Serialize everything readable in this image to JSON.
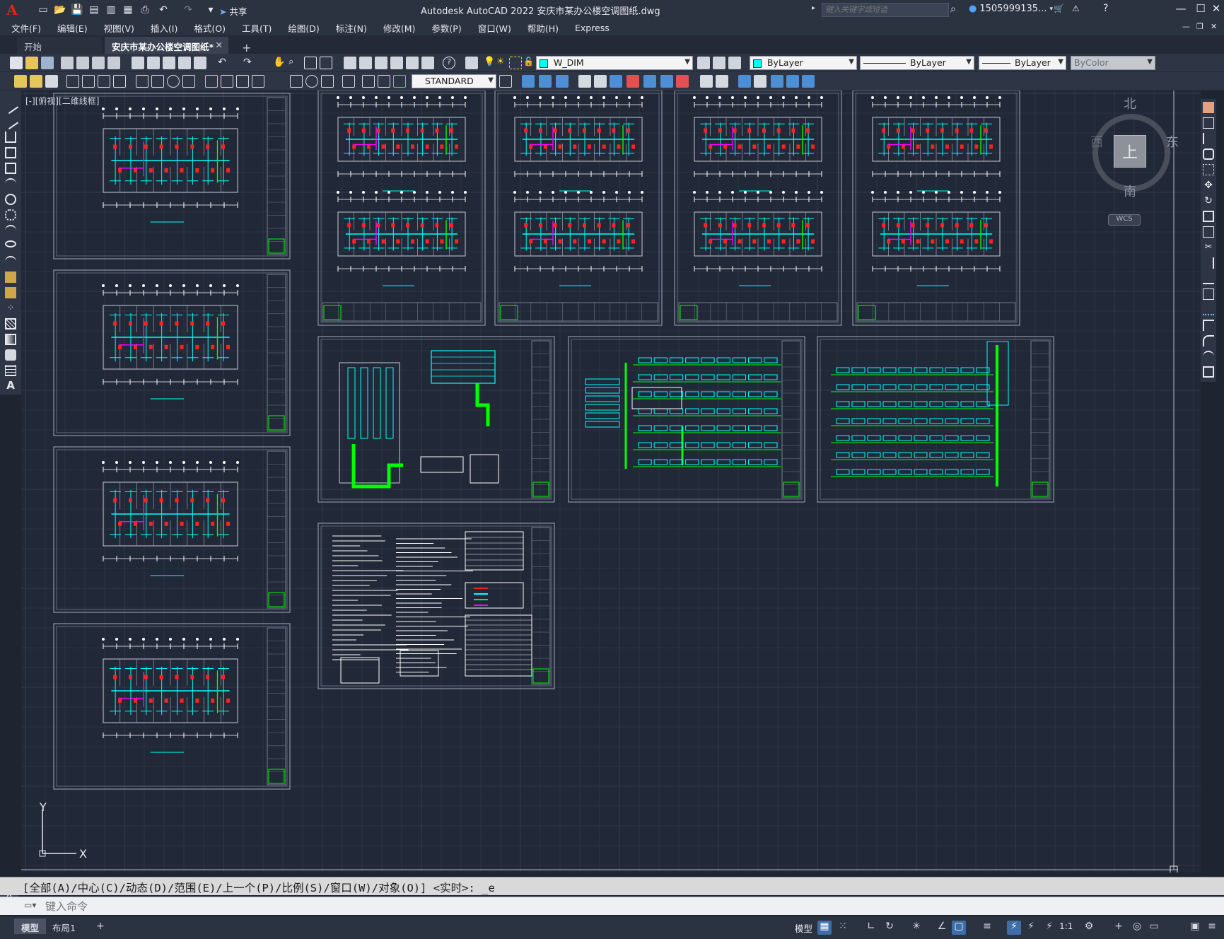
{
  "app": {
    "title": "Autodesk AutoCAD 2022    安庆市某办公楼空调图纸.dwg",
    "logo": "A",
    "search_placeholder": "键入关键字或短语",
    "account": "1505999135...",
    "share_label": "共享"
  },
  "menu": [
    "文件(F)",
    "编辑(E)",
    "视图(V)",
    "插入(I)",
    "格式(O)",
    "工具(T)",
    "绘图(D)",
    "标注(N)",
    "修改(M)",
    "参数(P)",
    "窗口(W)",
    "帮助(H)",
    "Express"
  ],
  "tabs": {
    "start": "开始",
    "drawing": "安庆市某办公楼空调图纸*",
    "add": "+"
  },
  "toolbar": {
    "layer": "W_DIM",
    "color": "ByLayer",
    "linetype": "ByLayer",
    "lineweight": "ByLayer",
    "plotstyle": "ByColor",
    "textstyle": "STANDARD"
  },
  "viewport_label": "[-][俯视][二维线框]",
  "viewcube": {
    "north": "北",
    "south": "南",
    "east": "东",
    "west": "西",
    "top": "上",
    "wcs": "WCS"
  },
  "ucs": {
    "x": "X",
    "y": "Y"
  },
  "command": {
    "history": "[全部(A)/中心(C)/动态(D)/范围(E)/上一个(P)/比例(S)/窗口(W)/对象(O)] <实时>: _e",
    "placeholder": "键入命令"
  },
  "status": {
    "model_tab": "模型",
    "layout1_tab": "布局1",
    "add_layout": "+",
    "model_button": "模型",
    "scale": "1:1"
  },
  "colors": {
    "canvas": "#212837",
    "cyan": "#00ffff",
    "green": "#00ff00",
    "red": "#ff2020",
    "magenta": "#ff00ff",
    "white": "#ffffff"
  }
}
